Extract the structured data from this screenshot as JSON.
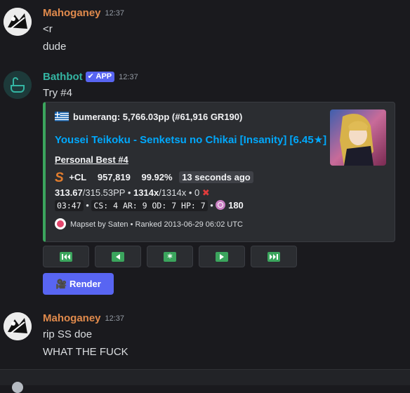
{
  "messages": [
    {
      "author": "Mahoganey",
      "time": "12:37",
      "lines": [
        "<r",
        "dude"
      ]
    },
    {
      "author": "Bathbot",
      "badge": "APP",
      "time": "12:37",
      "lines": [
        "Try #4"
      ]
    },
    {
      "author": "Mahoganey",
      "time": "12:37",
      "lines": [
        "rip SS doe",
        "WHAT THE FUCK"
      ]
    }
  ],
  "embed": {
    "author": "bumerang: 5,766.03pp (#61,916 GR190)",
    "title": "Yousei Teikoku - Senketsu no Chikai [Insanity] [6.45★]",
    "field_name": "Personal Best #4",
    "grade": "S",
    "mods": "+CL",
    "score": "957,819",
    "accuracy": "99.92%",
    "ago": "13 seconds ago",
    "pp": "313.67",
    "pp_max": "/315.53PP",
    "combo": "1314x",
    "combo_max": "/1314x",
    "misses": "0",
    "map_stats": "03:47",
    "map_stats_2": "CS: 4 AR: 9 OD: 7 HP: 7",
    "bpm": "180",
    "footer": "Mapset by Saten • Ranked 2013-06-29 06:02 UTC",
    "accent_color": "#3ba55d"
  },
  "buttons": [
    {
      "icon": "first-page-icon"
    },
    {
      "icon": "previous-page-icon"
    },
    {
      "icon": "asterisk-icon"
    },
    {
      "icon": "next-page-icon"
    },
    {
      "icon": "last-page-icon"
    }
  ],
  "render_button": {
    "label": "Render",
    "icon": "movie-camera-icon"
  },
  "colors": {
    "background": "#1a1a1e",
    "embed_bg": "#2b2d31",
    "link": "#00a8fc",
    "blurple": "#5865f2",
    "button_icon": "#3ba55d"
  }
}
